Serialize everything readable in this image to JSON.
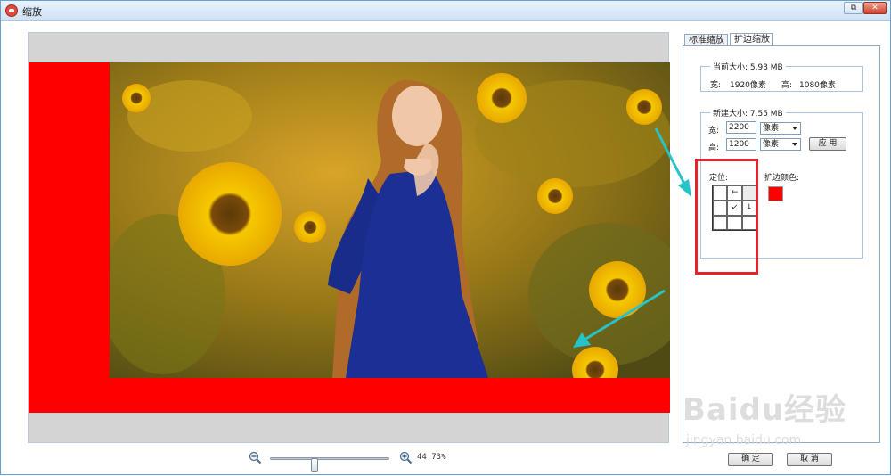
{
  "window": {
    "title": "缩放",
    "restore_glyph": "⧉",
    "close_glyph": "✕"
  },
  "zoom": {
    "percent": "44.73%",
    "slider_fraction": 0.36
  },
  "tabs": [
    {
      "label": "标准缩放",
      "active": false
    },
    {
      "label": "扩边缩放",
      "active": true
    }
  ],
  "current_size": {
    "legend": "当前大小: 5.93 MB",
    "width_label": "宽:",
    "width_value": "1920像素",
    "height_label": "高:",
    "height_value": "1080像素"
  },
  "new_size": {
    "legend": "新建大小: 7.55 MB",
    "width_label": "宽:",
    "width_value": "2200",
    "width_unit": "像素",
    "height_label": "高:",
    "height_value": "1200",
    "height_unit": "像素",
    "apply_label": "应 用"
  },
  "anchor": {
    "label": "定位:",
    "cells": [
      "",
      "←",
      "",
      "",
      "↙",
      "↓",
      "",
      "",
      ""
    ],
    "selected_index": 2
  },
  "expand_color": {
    "label": "扩边颜色:",
    "color": "#ff0000"
  },
  "buttons": {
    "ok": "确 定",
    "cancel": "取 消"
  },
  "watermark": {
    "brand": "Baidu经验",
    "url": "jingyan.baidu.com"
  },
  "colors": {
    "fill": "#ff0000",
    "highlight": "#e8232e",
    "arrow": "#27c3c8",
    "canvas_bg": "#d4d4d4"
  }
}
